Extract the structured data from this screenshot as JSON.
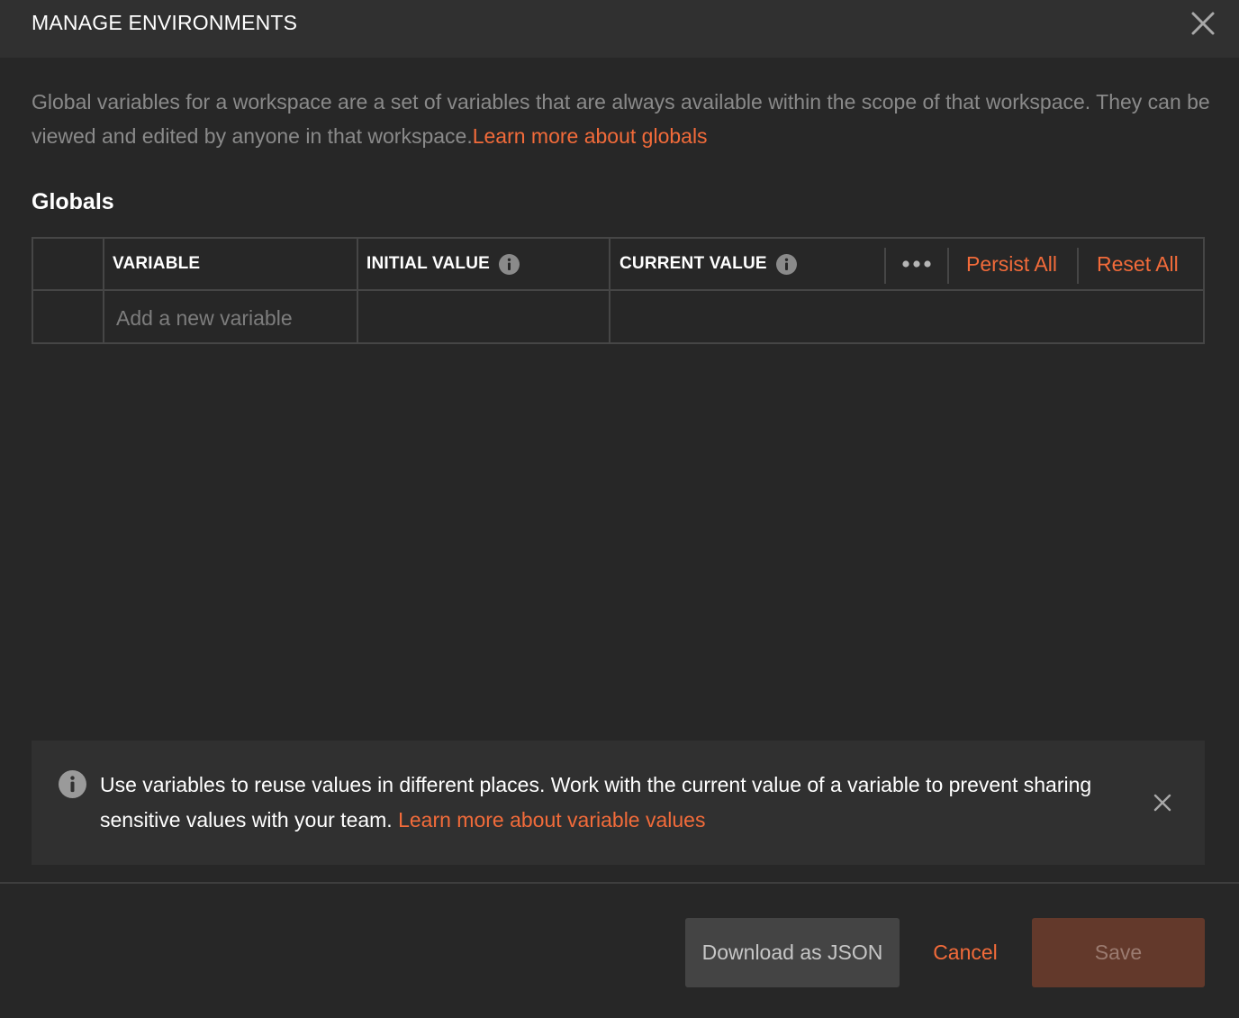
{
  "modal": {
    "title": "MANAGE ENVIRONMENTS"
  },
  "description": {
    "text": "Global variables for a workspace are a set of variables that are always available within the scope of that workspace. They can be viewed and edited by anyone in that workspace.",
    "link": "Learn more about globals"
  },
  "section": {
    "title": "Globals"
  },
  "table": {
    "columns": {
      "variable": "VARIABLE",
      "initial_value": "INITIAL VALUE",
      "current_value": "CURRENT VALUE"
    },
    "more_label": "•••",
    "persist_all": "Persist All",
    "reset_all": "Reset All",
    "new_variable_placeholder": "Add a new variable"
  },
  "banner": {
    "text": "Use variables to reuse values in different places. Work with the current value of a variable to prevent sharing sensitive values with your team.",
    "link": "Learn more about variable values"
  },
  "footer": {
    "download_label": "Download as JSON",
    "cancel_label": "Cancel",
    "save_label": "Save"
  },
  "colors": {
    "background": "#272727",
    "header_background": "#303030",
    "accent": "#f26b3a",
    "border": "#464646",
    "save_disabled": "#63392b"
  },
  "icons": {
    "close": "close-icon",
    "info": "info-icon",
    "more": "more-horizontal-icon"
  }
}
